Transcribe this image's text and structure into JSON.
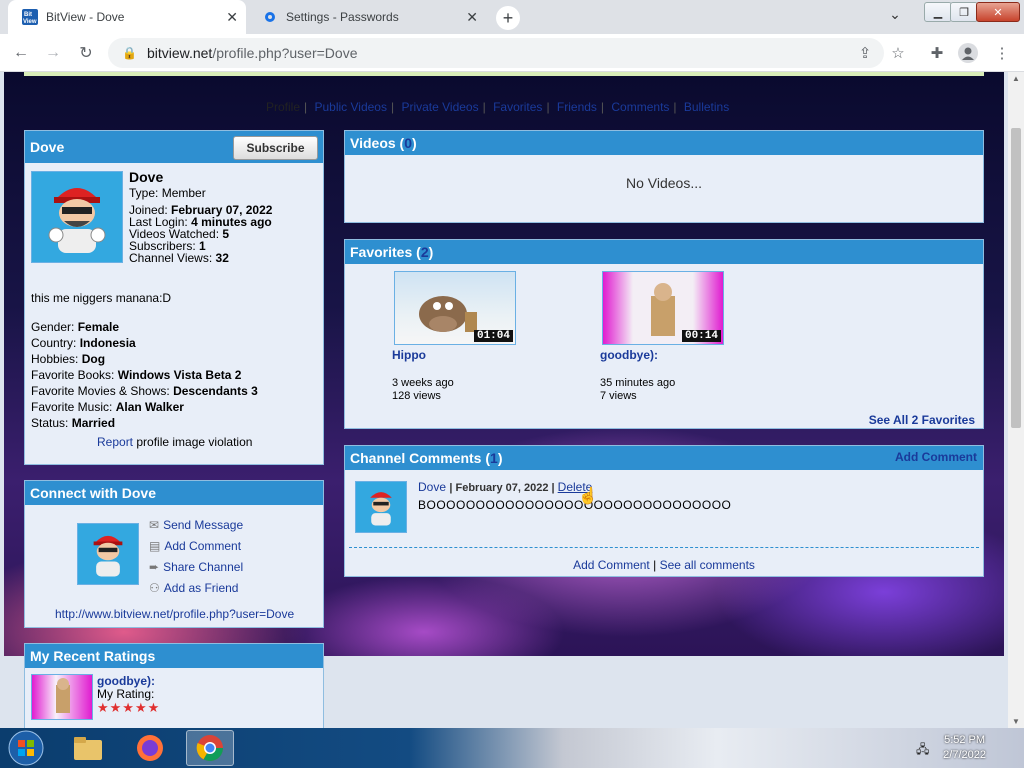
{
  "browser": {
    "tabs": [
      {
        "title": "BitView - Dove",
        "active": true
      },
      {
        "title": "Settings - Passwords",
        "active": false
      }
    ],
    "url_host": "bitview.net",
    "url_path": "/profile.php?user=Dove"
  },
  "profile_nav": {
    "items": [
      "Profile",
      "Public Videos",
      "Private Videos",
      "Favorites",
      "Friends",
      "Comments",
      "Bulletins"
    ],
    "current": "Profile"
  },
  "profile": {
    "header": "Dove",
    "subscribe_label": "Subscribe",
    "name": "Dove",
    "type_label": "Type:",
    "type_value": "Member",
    "joined_label": "Joined:",
    "joined_value": "February 07, 2022",
    "last_login_label": "Last Login:",
    "last_login_value": "4 minutes ago",
    "videos_watched_label": "Videos Watched:",
    "videos_watched_value": "5",
    "subscribers_label": "Subscribers:",
    "subscribers_value": "1",
    "channel_views_label": "Channel Views:",
    "channel_views_value": "32",
    "bio": "this me niggers manana:D",
    "details": [
      {
        "label": "Gender:",
        "value": "Female"
      },
      {
        "label": "Country:",
        "value": "Indonesia"
      },
      {
        "label": "Hobbies:",
        "value": "Dog"
      },
      {
        "label": "Favorite Books:",
        "value": "Windows Vista Beta 2"
      },
      {
        "label": "Favorite Movies & Shows:",
        "value": "Descendants 3"
      },
      {
        "label": "Favorite Music:",
        "value": "Alan Walker"
      },
      {
        "label": "Status:",
        "value": "Married"
      }
    ],
    "report_link": "Report",
    "report_text": "profile image violation"
  },
  "connect": {
    "header": "Connect with Dove",
    "actions": [
      "Send Message",
      "Add Comment",
      "Share Channel",
      "Add as Friend"
    ],
    "profile_url": "http://www.bitview.net/profile.php?user=Dove"
  },
  "ratings": {
    "header": "My Recent Ratings",
    "item_title": "goodbye):",
    "my_rating_label": "My Rating:",
    "stars": "★★★★★"
  },
  "videos": {
    "header": "Videos",
    "count": "0",
    "empty_text": "No Videos..."
  },
  "favorites": {
    "header": "Favorites",
    "count": "2",
    "items": [
      {
        "title": "Hippo",
        "duration": "01:04",
        "age": "3 weeks ago",
        "views": "128 views"
      },
      {
        "title": "goodbye):",
        "duration": "00:14",
        "age": "35 minutes ago",
        "views": "7 views"
      }
    ],
    "see_all": "See All 2 Favorites"
  },
  "comments": {
    "header": "Channel Comments",
    "count": "1",
    "add_link": "Add Comment",
    "items": [
      {
        "author": "Dove",
        "date": "February 07, 2022",
        "delete": "Delete",
        "text": "BOOOOOOOOOOOOOOOOOOOOOOOOOOOOOOO"
      }
    ],
    "footer_add": "Add Comment",
    "footer_see_all": "See all comments"
  },
  "taskbar": {
    "time": "5:52 PM",
    "date": "2/7/2022"
  }
}
